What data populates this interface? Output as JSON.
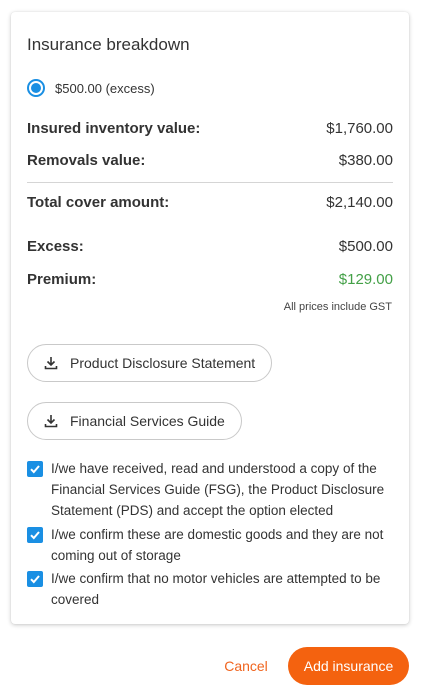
{
  "title": "Insurance breakdown",
  "excess_option": {
    "label": "$500.00 (excess)",
    "selected": true
  },
  "rows": [
    {
      "label": "Insured inventory value:",
      "value": "$1,760.00"
    },
    {
      "label": "Removals value:",
      "value": "$380.00"
    },
    {
      "label": "Total cover amount:",
      "value": "$2,140.00"
    },
    {
      "label": "Excess:",
      "value": "$500.00"
    },
    {
      "label": "Premium:",
      "value": "$129.00"
    }
  ],
  "gst_note": "All prices include GST",
  "documents": [
    {
      "label": "Product Disclosure Statement",
      "icon": "download-icon"
    },
    {
      "label": "Financial Services Guide",
      "icon": "download-icon"
    }
  ],
  "confirmations": [
    {
      "text": "I/we have received, read and understood a copy of the Financial Services Guide (FSG), the Product Disclosure Statement (PDS) and accept the option elected",
      "checked": true
    },
    {
      "text": "I/we confirm these are domestic goods and they are not coming out of storage",
      "checked": true
    },
    {
      "text": "I/we confirm that no motor vehicles are attempted to be covered",
      "checked": true
    }
  ],
  "actions": {
    "cancel": "Cancel",
    "add": "Add insurance"
  },
  "colors": {
    "accent_blue": "#1a8fe3",
    "premium_green": "#43a047",
    "orange": "#f4620f"
  }
}
